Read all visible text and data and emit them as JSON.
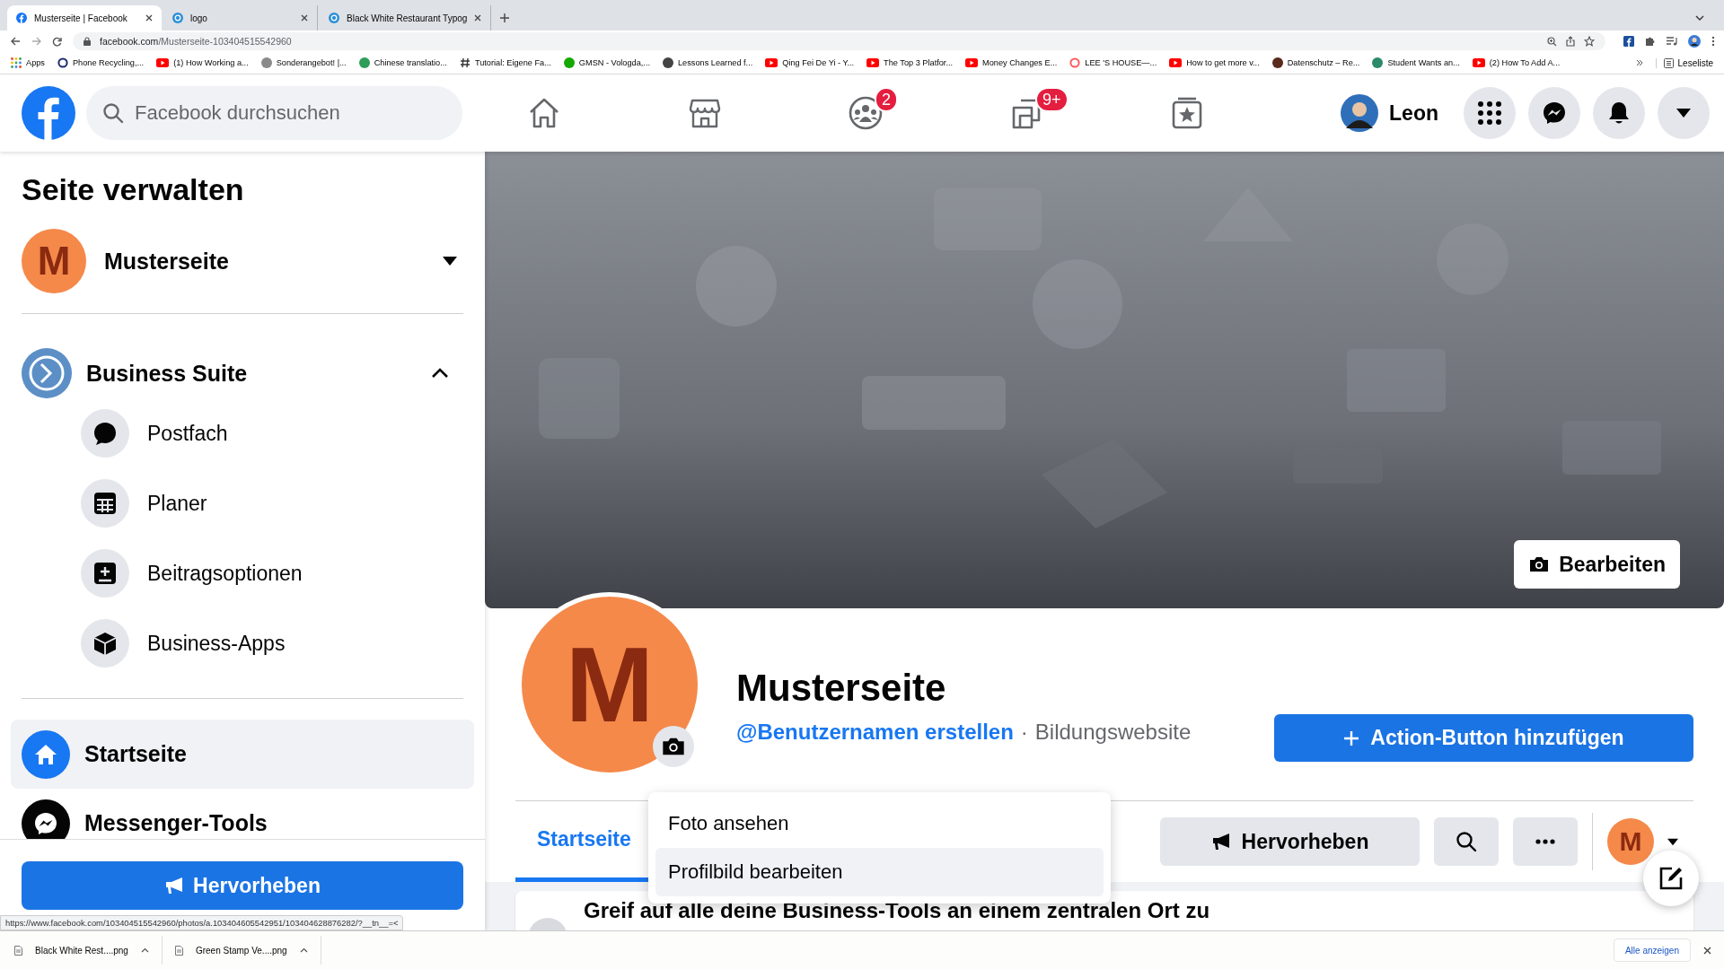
{
  "browser": {
    "tabs": [
      {
        "title": "Musterseite | Facebook",
        "selected": true,
        "kind": "facebook"
      },
      {
        "title": "logo",
        "selected": false,
        "kind": "canva"
      },
      {
        "title": "Black White Restaurant Typog",
        "selected": false,
        "kind": "canva"
      }
    ],
    "url": {
      "domain": "facebook.com",
      "path": "/Musterseite-103404515542960"
    },
    "bookmarks": [
      {
        "label": "Apps",
        "kind": "apps"
      },
      {
        "label": "Phone Recycling,...",
        "kind": "ring",
        "color": "#1a2b6d"
      },
      {
        "label": "(1) How Working a...",
        "kind": "youtube"
      },
      {
        "label": "Sonderangebot! |...",
        "kind": "dot",
        "color": "#8a8a8a"
      },
      {
        "label": "Chinese translatio...",
        "kind": "dot",
        "color": "#2e9d57"
      },
      {
        "label": "Tutorial: Eigene Fa...",
        "kind": "hash"
      },
      {
        "label": "GMSN - Vologda,...",
        "kind": "dot",
        "color": "#14a800"
      },
      {
        "label": "Lessons Learned f...",
        "kind": "dot",
        "color": "#444444"
      },
      {
        "label": "Qing Fei De Yi - Y...",
        "kind": "youtube"
      },
      {
        "label": "The Top 3 Platfor...",
        "kind": "youtube"
      },
      {
        "label": "Money Changes E...",
        "kind": "youtube"
      },
      {
        "label": "LEE 'S HOUSE—...",
        "kind": "ring",
        "color": "#ff5a5f"
      },
      {
        "label": "How to get more v...",
        "kind": "youtube"
      },
      {
        "label": "Datenschutz – Re...",
        "kind": "dot",
        "color": "#5a2a1a"
      },
      {
        "label": "Student Wants an...",
        "kind": "dot",
        "color": "#2a8a6a"
      },
      {
        "label": "(2) How To Add A...",
        "kind": "youtube"
      }
    ],
    "reading_list": "Leseliste",
    "status_url": "https://www.facebook.com/103404515542960/photos/a.103404605542951/103404628876282/?__tn__=<",
    "downloads": [
      {
        "name": "Black White Rest....png"
      },
      {
        "name": "Green Stamp Ve....png"
      }
    ],
    "show_all": "Alle anzeigen"
  },
  "header": {
    "search": {
      "placeholder": "Facebook durchsuchen"
    },
    "nav": [
      {
        "kind": "home"
      },
      {
        "kind": "store"
      },
      {
        "kind": "groups",
        "badge": "2"
      },
      {
        "kind": "gaming",
        "badge": "9+"
      },
      {
        "kind": "pages"
      }
    ],
    "profile_name": "Leon",
    "round_buttons": [
      {
        "kind": "menu"
      },
      {
        "kind": "messenger"
      },
      {
        "kind": "bell"
      },
      {
        "kind": "caret"
      }
    ]
  },
  "sidebar": {
    "title": "Seite verwalten",
    "page": {
      "avatar_letter": "M",
      "name": "Musterseite"
    },
    "business_suite": {
      "label": "Business Suite",
      "expanded": true,
      "children": [
        {
          "label": "Postfach",
          "kind": "chat"
        },
        {
          "label": "Planer",
          "kind": "calendar"
        },
        {
          "label": "Beitragsoptionen",
          "kind": "post"
        },
        {
          "label": "Business-Apps",
          "kind": "cube"
        }
      ]
    },
    "items": [
      {
        "label": "Startseite",
        "kind": "home",
        "selected": true
      },
      {
        "label": "Messenger-Tools",
        "kind": "messenger",
        "selected": false
      }
    ],
    "promote_button": "Hervorheben"
  },
  "page": {
    "cover_button": "Bearbeiten",
    "avatar_letter": "M",
    "name": "Musterseite",
    "username_link": "@Benutzernamen erstellen",
    "separator": "·",
    "category": "Bildungswebsite",
    "action_button": "Action-Button hinzufügen",
    "tabs": [
      {
        "label": "Startseite",
        "selected": true
      }
    ],
    "promote_button": "Hervorheben",
    "tab_avatar_letter": "M",
    "photo_menu": [
      {
        "label": "Foto ansehen",
        "selected": false
      },
      {
        "label": "Profilbild bearbeiten",
        "selected": true
      }
    ],
    "card_text": "Greif auf alle deine Business-Tools an einem zentralen Ort zu"
  }
}
